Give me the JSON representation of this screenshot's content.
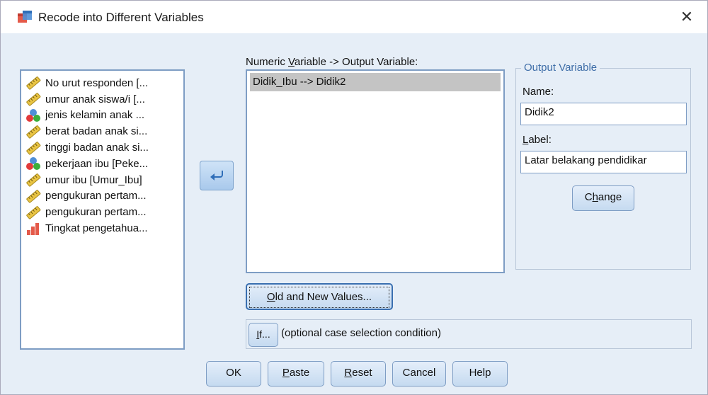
{
  "window": {
    "title": "Recode into Different Variables",
    "close_symbol": "✕"
  },
  "variables": [
    {
      "label": "No urut responden [...",
      "icon": "scale-ruler-icon"
    },
    {
      "label": "umur anak siswa/i [...",
      "icon": "scale-ruler-icon"
    },
    {
      "label": "jenis kelamin anak ...",
      "icon": "nominal-balls-icon"
    },
    {
      "label": "berat badan anak si...",
      "icon": "scale-ruler-icon"
    },
    {
      "label": "tinggi badan anak si...",
      "icon": "scale-ruler-icon"
    },
    {
      "label": "pekerjaan ibu [Peke...",
      "icon": "nominal-balls-icon"
    },
    {
      "label": "umur ibu [Umur_Ibu]",
      "icon": "scale-ruler-icon"
    },
    {
      "label": "pengukuran pertam...",
      "icon": "scale-ruler-icon"
    },
    {
      "label": "pengukuran pertam...",
      "icon": "scale-ruler-icon"
    },
    {
      "label": "Tingkat pengetahua...",
      "icon": "ordinal-bars-icon"
    }
  ],
  "mapping": {
    "label_pre": "Numeric ",
    "label_ul": "V",
    "label_post": "ariable -> Output Variable:",
    "rows": [
      "Didik_Ibu --> Didik2"
    ]
  },
  "output_variable": {
    "legend": "Output Variable",
    "name_label": "Name:",
    "name_value": "Didik2",
    "label_label_ul": "L",
    "label_label_rest": "abel:",
    "label_value": "Latar belakang pendidikar",
    "change_pre": "C",
    "change_ul": "h",
    "change_post": "ange"
  },
  "old_new": {
    "ul": "O",
    "rest": "ld and New Values..."
  },
  "if_section": {
    "button_ul": "I",
    "button_rest": "f...",
    "hint": "(optional case selection condition)"
  },
  "buttons": {
    "ok": "OK",
    "paste_ul": "P",
    "paste_rest": "aste",
    "reset_ul": "R",
    "reset_rest": "eset",
    "cancel": "Cancel",
    "help": "Help"
  },
  "colors": {
    "accent": "#3f6ea8",
    "panel": "#e6eef7",
    "selected_row": "#c4c4c4"
  }
}
